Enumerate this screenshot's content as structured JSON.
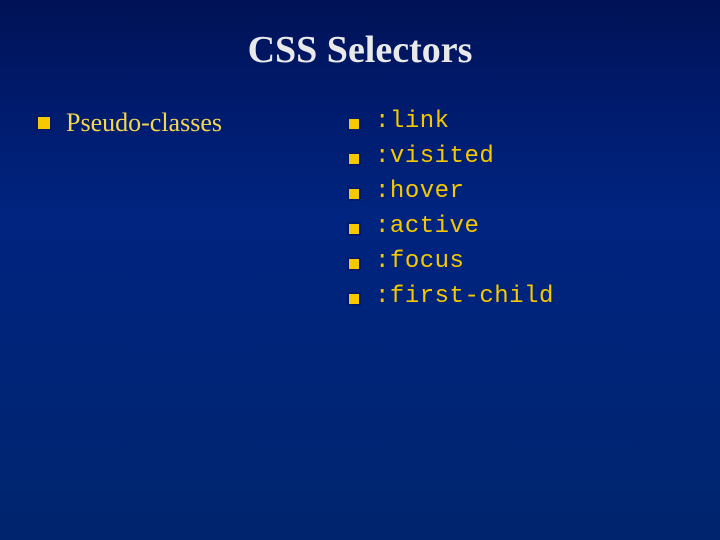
{
  "title": "CSS Selectors",
  "left": {
    "heading": "Pseudo-classes"
  },
  "pseudo": [
    ":link",
    ":visited",
    ":hover",
    ":active",
    ":focus",
    ":first-child"
  ]
}
